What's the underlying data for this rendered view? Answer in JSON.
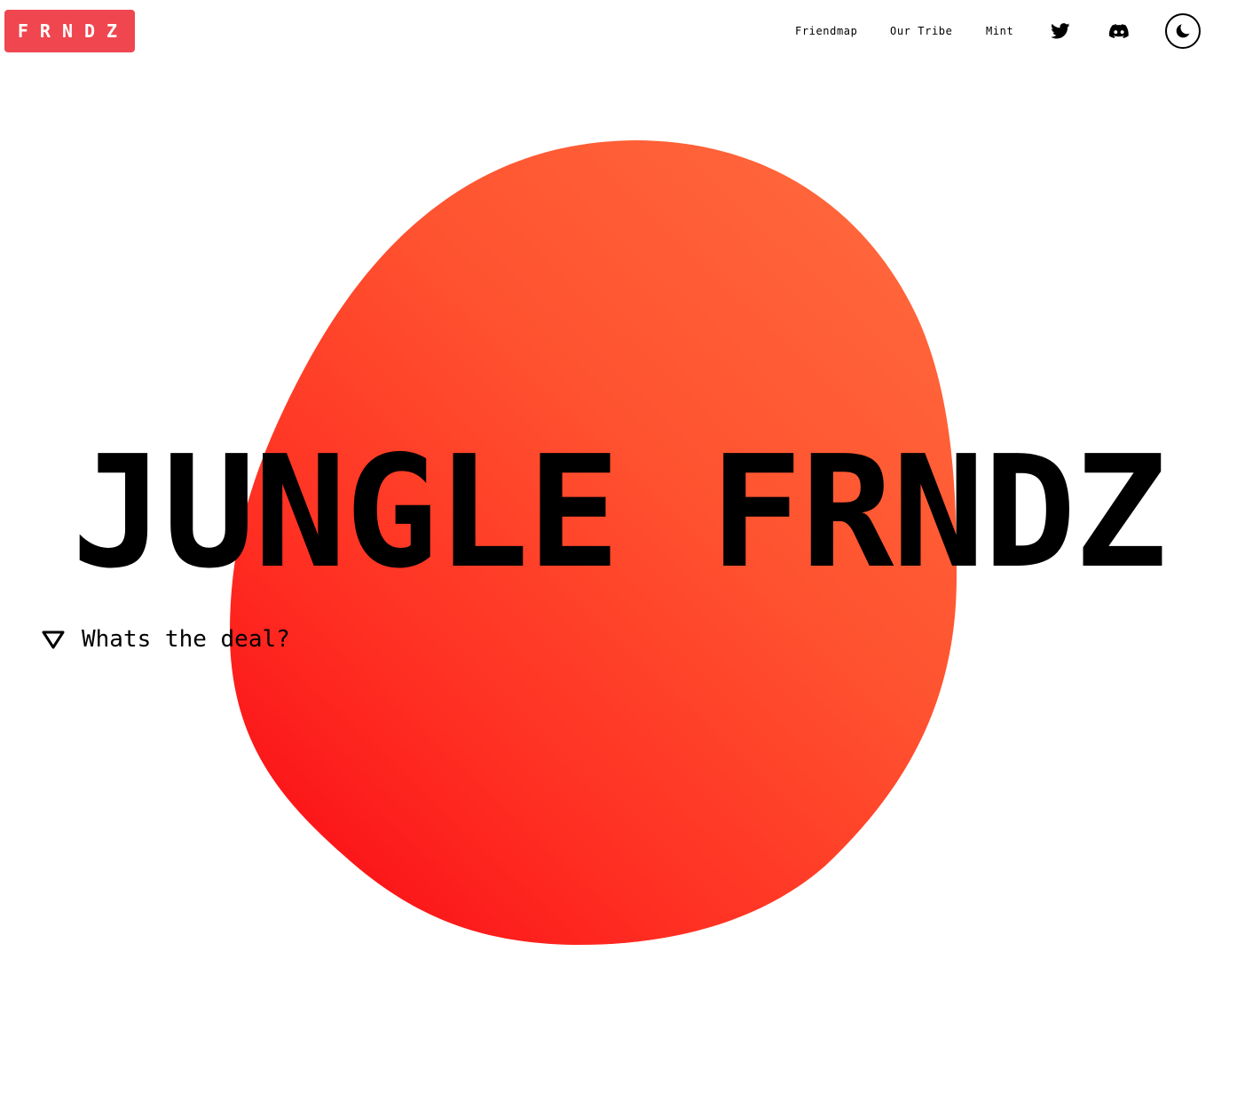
{
  "brand": {
    "logo": "FRNDZ",
    "logo_color": "#ef4650"
  },
  "nav": {
    "links": [
      "Friendmap",
      "Our Tribe",
      "Mint"
    ],
    "icons": [
      "twitter-icon",
      "discord-icon",
      "moon-icon"
    ]
  },
  "hero": {
    "title": "JUNGLE FRNDZ",
    "cta": "Whats the deal?",
    "cta_icon": "triangle-down-icon",
    "blob_colors": [
      "#fa0d16",
      "#ff6a3d"
    ]
  }
}
